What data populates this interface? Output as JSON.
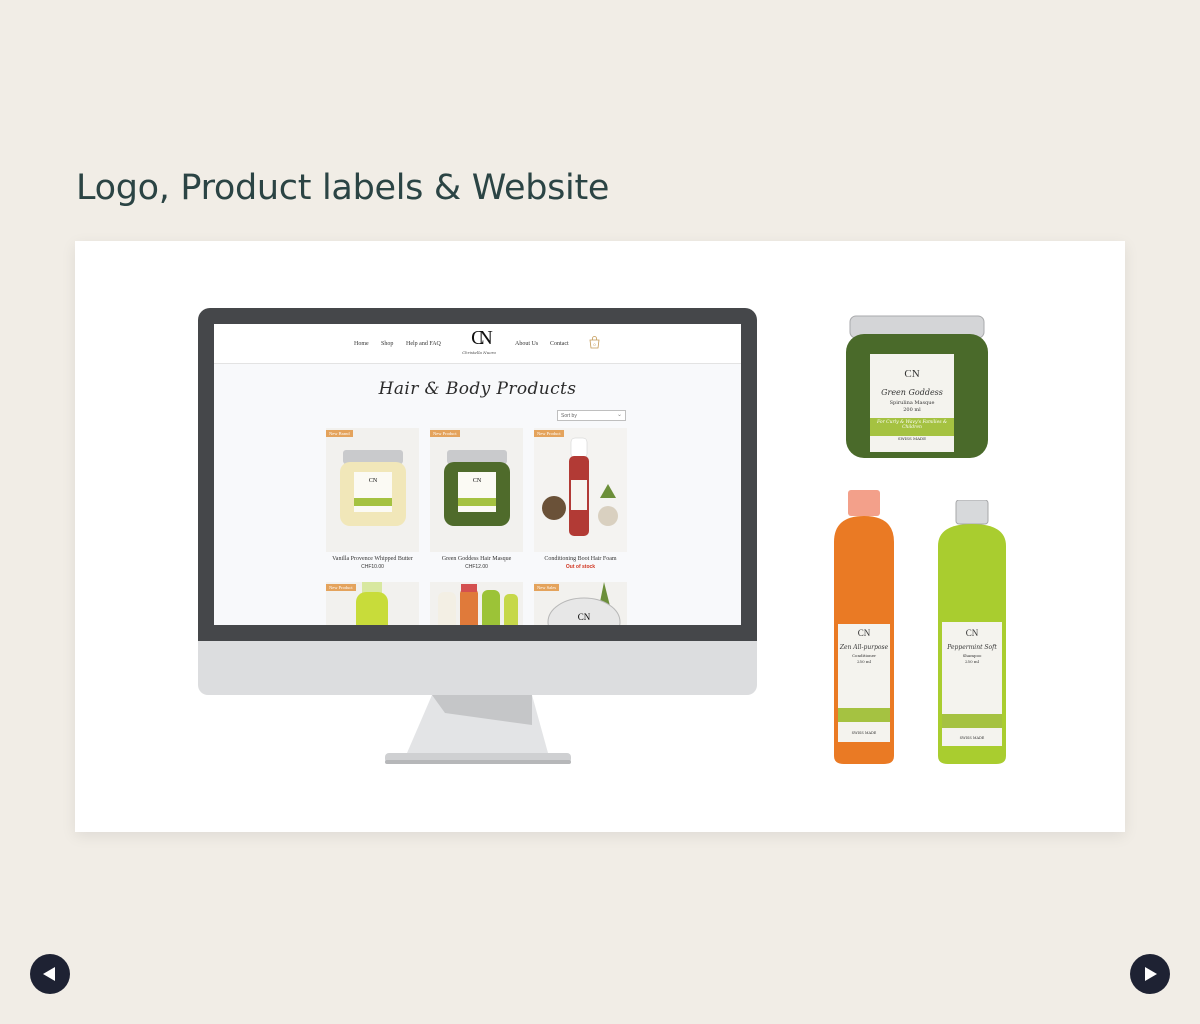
{
  "section_title": "Logo, Product labels & Website",
  "site": {
    "nav_left": [
      "Home",
      "Shop",
      "Help and FAQ"
    ],
    "nav_right": [
      "About Us",
      "Contact"
    ],
    "logo_mark": "CN",
    "logo_sub": "Christella Nuoro",
    "cart_count": "0",
    "page_heading": "Hair & Body Products",
    "sort_label": "Sort by",
    "products": [
      {
        "badge": "New Brand",
        "name": "Vanilla Provence Whipped Butter",
        "price": "CHF10.00",
        "jar_color": "#f1e7b9"
      },
      {
        "badge": "New Product",
        "name": "Green Goddess Hair Masque",
        "price": "CHF12.00",
        "jar_color": "#4f6b2b"
      },
      {
        "badge": "New Product",
        "name": "Conditioning Boot Hair Foam",
        "price": "Out of stock",
        "jar_color": "#b23a35"
      }
    ],
    "products_row2": [
      {
        "badge": "New Product"
      },
      {
        "badge": ""
      },
      {
        "badge": "New Sales"
      }
    ]
  },
  "product_labels": {
    "jar": {
      "mark": "CN",
      "name": "Green Goddess",
      "sub": "Spirulina Masque",
      "size": "200 ml",
      "tag": "For Curly & Wavy's Families & Children",
      "footer": "SWISS MADE"
    },
    "bottle_orange": {
      "mark": "CN",
      "name": "Zen All-purpose",
      "sub": "Conditioner",
      "size": "250 ml",
      "footer": "SWISS MADE"
    },
    "bottle_green": {
      "mark": "CN",
      "name": "Peppermint Soft",
      "sub": "Shampoo",
      "size": "250 ml",
      "footer": "SWISS MADE"
    }
  },
  "colors": {
    "background": "#f1ede6",
    "title": "#2b4444",
    "accent_green": "#a5c241",
    "badge": "#e4a35c",
    "out_of_stock": "#d0341f",
    "arrow": "#1e2233"
  },
  "controls": {
    "prev_icon": "play-left-icon",
    "next_icon": "play-right-icon"
  }
}
